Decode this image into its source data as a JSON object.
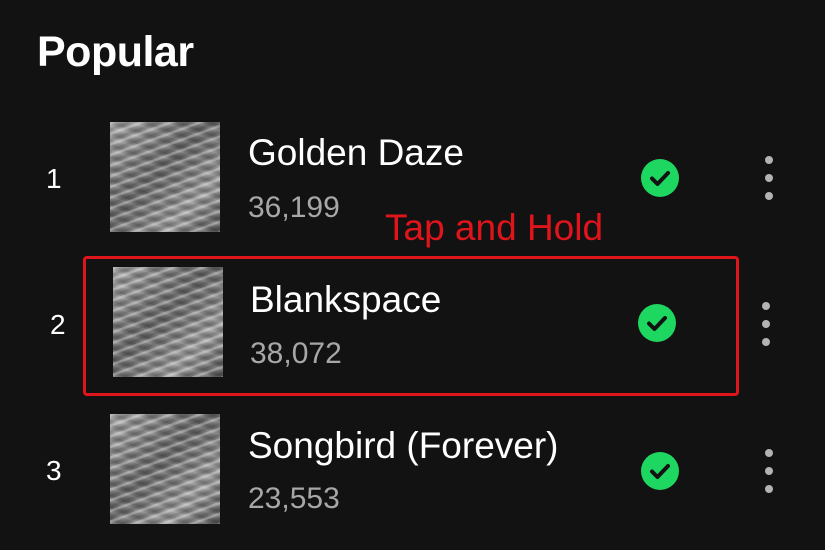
{
  "section": {
    "title": "Popular"
  },
  "tracks": [
    {
      "rank": "1",
      "title": "Golden Daze",
      "plays": "36,199",
      "downloaded": true
    },
    {
      "rank": "2",
      "title": "Blankspace",
      "plays": "38,072",
      "downloaded": true
    },
    {
      "rank": "3",
      "title": "Songbird (Forever)",
      "plays": "23,553",
      "downloaded": true
    }
  ],
  "annotation": {
    "label": "Tap and Hold",
    "color": "#e0141b"
  },
  "colors": {
    "background": "#121212",
    "accent_green": "#1ed760",
    "secondary_text": "#a7a7a7"
  },
  "icons": {
    "downloaded": "downloaded-check-icon",
    "more": "more-options-icon"
  }
}
